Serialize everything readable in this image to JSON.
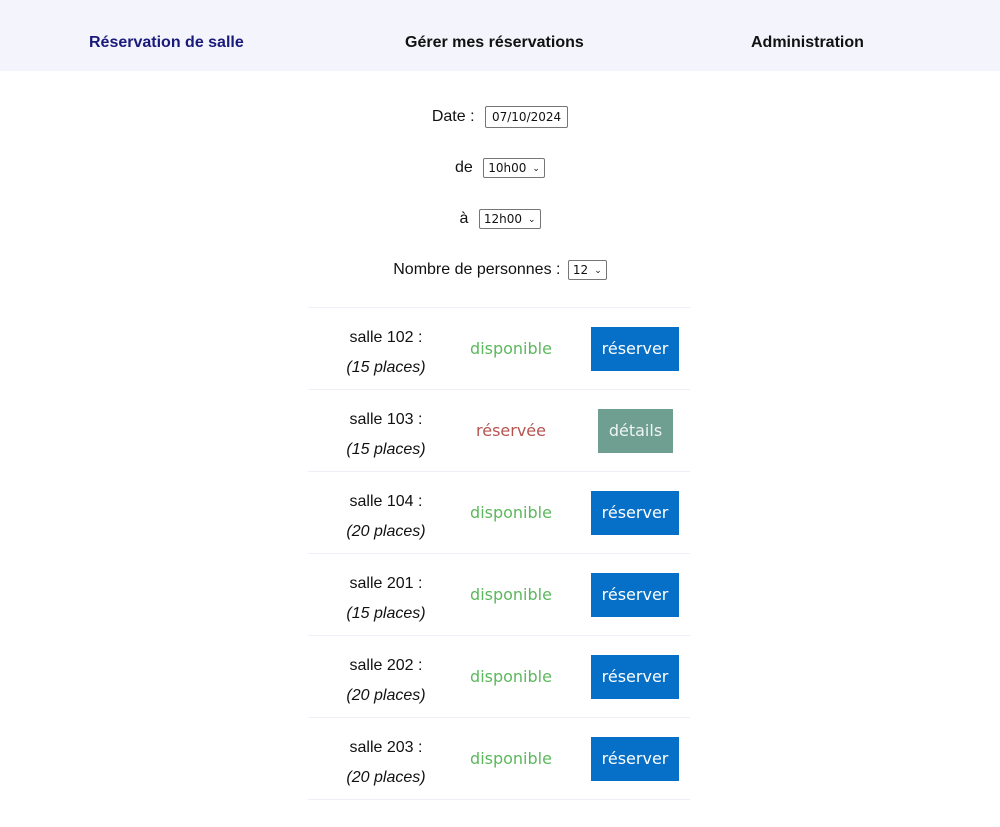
{
  "nav": {
    "items": [
      {
        "label": "Réservation de salle",
        "active": true
      },
      {
        "label": "Gérer mes réservations",
        "active": false
      },
      {
        "label": "Administration",
        "active": false
      }
    ]
  },
  "form": {
    "date_label": "Date :",
    "date_value": "07/10/2024",
    "from_label": "de",
    "from_value": "10h00",
    "to_label": "à",
    "to_value": "12h00",
    "people_label": "Nombre de personnes :",
    "people_value": "12"
  },
  "rooms": [
    {
      "name": "salle 102 :",
      "capacity": "(15 places)",
      "status": "disponible",
      "action": "réserver"
    },
    {
      "name": "salle 103 :",
      "capacity": "(15 places)",
      "status": "réservée",
      "action": "détails"
    },
    {
      "name": "salle 104 :",
      "capacity": "(20 places)",
      "status": "disponible",
      "action": "réserver"
    },
    {
      "name": "salle 201 :",
      "capacity": "(15 places)",
      "status": "disponible",
      "action": "réserver"
    },
    {
      "name": "salle 202 :",
      "capacity": "(20 places)",
      "status": "disponible",
      "action": "réserver"
    },
    {
      "name": "salle 203 :",
      "capacity": "(20 places)",
      "status": "disponible",
      "action": "réserver"
    }
  ],
  "colors": {
    "nav_bg": "#f4f4fd",
    "nav_active": "#1a1a7a",
    "available": "#5cb85c",
    "reserved": "#b5544f",
    "reserve_button": "#0670c8",
    "details_button": "#6f9f91"
  }
}
